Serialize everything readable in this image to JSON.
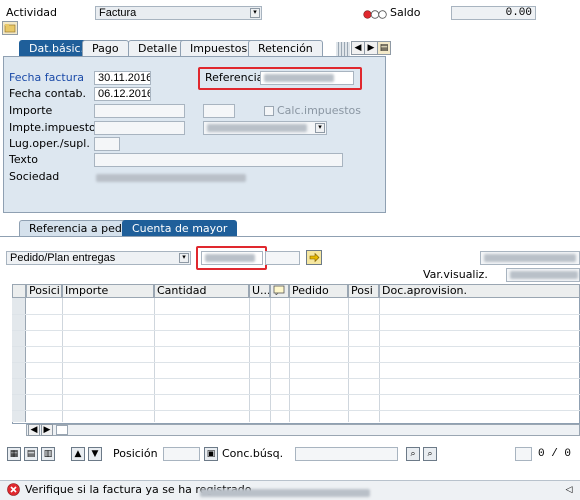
{
  "header": {
    "actividad_label": "Actividad",
    "actividad_value": "Factura",
    "saldo_label": "Saldo",
    "saldo_value": "0.00",
    "status_colors": {
      "red": "#e0282e",
      "gray": "#cfd3d7"
    }
  },
  "top_tabs": [
    {
      "label": "Dat.básic."
    },
    {
      "label": "Pago"
    },
    {
      "label": "Detalle"
    },
    {
      "label": "Impuestos"
    },
    {
      "label": "Retención"
    }
  ],
  "basic": {
    "fecha_factura_label": "Fecha factura",
    "fecha_factura_value": "30.11.2016",
    "fecha_contab_label": "Fecha contab.",
    "fecha_contab_value": "06.12.2016",
    "referencia_label": "Referencia",
    "importe_label": "Importe",
    "calc_label": "Calc.impuestos",
    "impte_label": "Impte.impuesto",
    "lug_label": "Lug.oper./supl.",
    "texto_label": "Texto",
    "sociedad_label": "Sociedad"
  },
  "ref_tabs": [
    {
      "label": "Referencia a pedido"
    },
    {
      "label": "Cuenta de mayor"
    }
  ],
  "pedido": {
    "select_value": "Pedido/Plan entregas",
    "var_visualiz_label": "Var.visualiz."
  },
  "grid": {
    "columns": [
      "Posici",
      "Importe",
      "Cantidad",
      "U...",
      "",
      "Pedido",
      "Posi",
      "Doc.aprovision."
    ]
  },
  "bottom": {
    "posicion_label": "Posición",
    "conc_label": "Conc.búsq.",
    "pager": "0 / 0"
  },
  "status_bar": {
    "message": "Verifique si la factura ya se ha registrado"
  }
}
